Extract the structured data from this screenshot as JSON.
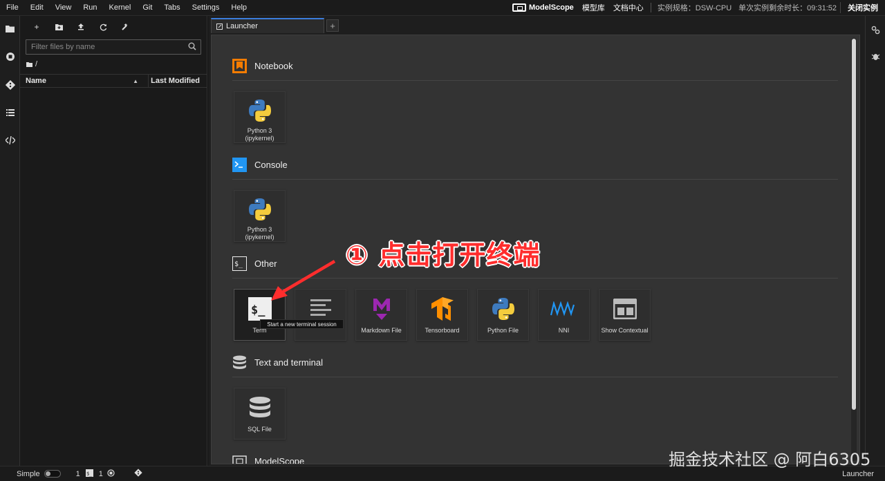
{
  "menu": [
    "File",
    "Edit",
    "View",
    "Run",
    "Kernel",
    "Git",
    "Tabs",
    "Settings",
    "Help"
  ],
  "topbar": {
    "brand": "ModelScope",
    "model_hub": "模型库",
    "docs": "文档中心",
    "instance_spec": "实例规格：DSW-CPU",
    "remaining_time": "单次实例剩余时长：09:31:52",
    "close_instance": "关闭实例"
  },
  "file_browser": {
    "filter_placeholder": "Filter files by name",
    "breadcrumb": "/",
    "col_name": "Name",
    "col_modified": "Last Modified"
  },
  "tabs": [
    {
      "label": "Launcher"
    }
  ],
  "launcher": {
    "sections": [
      {
        "title": "Notebook",
        "cards": [
          {
            "label": "Python 3 (ipykernel)"
          }
        ]
      },
      {
        "title": "Console",
        "cards": [
          {
            "label": "Python 3 (ipykernel)"
          }
        ]
      },
      {
        "title": "Other",
        "cards": [
          {
            "label": "Terminal"
          },
          {
            "label": "Text File"
          },
          {
            "label": "Markdown File"
          },
          {
            "label": "Tensorboard"
          },
          {
            "label": "Python File"
          },
          {
            "label": "NNI"
          },
          {
            "label": "Show Contextual"
          }
        ]
      },
      {
        "title": "Text and terminal",
        "cards": [
          {
            "label": "SQL File"
          }
        ]
      },
      {
        "title": "ModelScope",
        "cards": []
      }
    ],
    "tooltip": "Start a new terminal session",
    "terminal_visible_label": "Term"
  },
  "statusbar": {
    "mode_label": "Simple",
    "terminals": "1",
    "kernels": "1",
    "active": "Launcher"
  },
  "annotation": "① 点击打开终端",
  "watermark": "掘金技术社区 @ 阿白6305",
  "colors": {
    "notebook_icon": "#f57c00",
    "console_icon": "#2196f3",
    "annotation_red": "#ff2d2d",
    "markdown_purple": "#9c27b0",
    "tensorboard_orange": "#ff8f00"
  }
}
